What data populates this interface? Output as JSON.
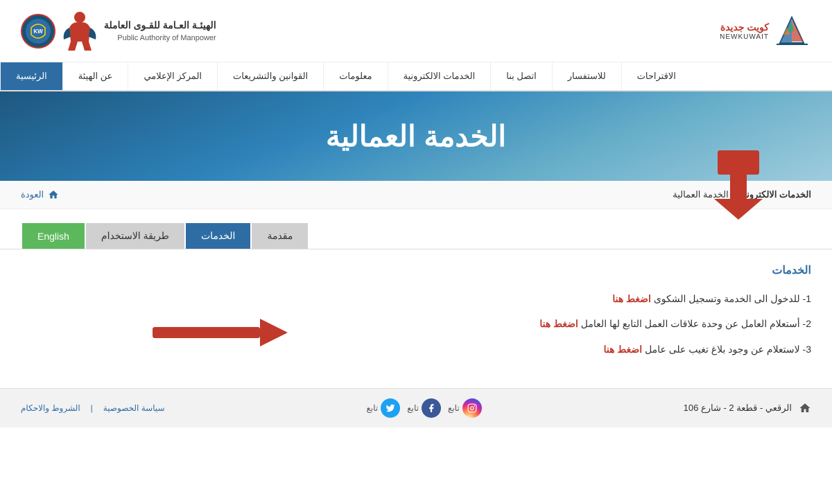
{
  "header": {
    "newkuwait_arabic": "كويت جديدة",
    "newkuwait_english": "NEWKUWAIT",
    "org_arabic_line1": "الهيئـة العـامة للقـوى العاملة",
    "org_english_line1": "Public Authority of Manpower"
  },
  "nav": {
    "items": [
      {
        "label": "الرئيسية",
        "active": true
      },
      {
        "label": "عن الهيئة",
        "active": false
      },
      {
        "label": "المركز الإعلامي",
        "active": false
      },
      {
        "label": "القوانين والتشريعات",
        "active": false
      },
      {
        "label": "معلومات",
        "active": false
      },
      {
        "label": "الخدمات الالكترونية",
        "active": false
      },
      {
        "label": "اتصل بنا",
        "active": false
      },
      {
        "label": "للاستفسار",
        "active": false
      },
      {
        "label": "الاقتراحات",
        "active": false
      }
    ]
  },
  "hero": {
    "title": "الخدمة العمالية"
  },
  "breadcrumb": {
    "home_icon": "home",
    "back_label": "العودة",
    "crumb1": "الخدمات الالكترونية",
    "crumb2": "الخدمة العمالية",
    "separator": "\\"
  },
  "tabs": {
    "items": [
      {
        "label": "مقدمة",
        "active": false
      },
      {
        "label": "الخدمات",
        "active": true
      },
      {
        "label": "طريقة الاستخدام",
        "active": false
      },
      {
        "label": "English",
        "active": false,
        "special": "english"
      }
    ]
  },
  "content": {
    "section_title": "الخدمات",
    "services": [
      {
        "number": "1",
        "text": "للدخول الى الخدمة وتسجيل الشكوى",
        "link_text": "اضغط هنا"
      },
      {
        "number": "2",
        "text": "أستعلام العامل عن وحدة علاقات العمل التابع لها العامل",
        "link_text": "اضغط هنا"
      },
      {
        "number": "3",
        "text": "لاستعلام عن وجود بلاغ تغيب على عامل",
        "link_text": "اضغط هنا"
      }
    ]
  },
  "footer": {
    "address": "الرقعي - قطعة 2 - شارع 106",
    "follow_label": "تابع",
    "social": [
      {
        "name": "twitter",
        "label": "تابع"
      },
      {
        "name": "facebook",
        "label": "تابع"
      },
      {
        "name": "instagram",
        "label": "تابع"
      }
    ],
    "links": [
      {
        "label": "سياسة الخصوصية"
      },
      {
        "separator": "|"
      },
      {
        "label": "الشروط والاحكام"
      }
    ]
  }
}
